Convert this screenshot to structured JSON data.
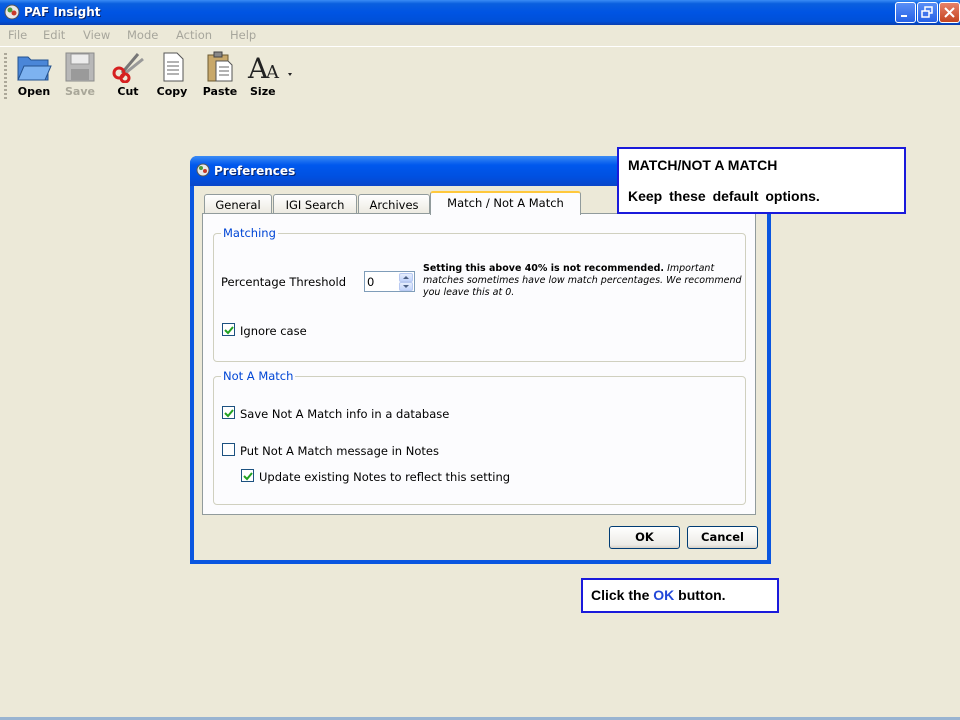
{
  "window": {
    "title": "PAF Insight"
  },
  "menu": [
    "File",
    "Edit",
    "View",
    "Mode",
    "Action",
    "Help"
  ],
  "toolbar": {
    "open": "Open",
    "save": "Save",
    "cut": "Cut",
    "copy": "Copy",
    "paste": "Paste",
    "size": "Size"
  },
  "dialog": {
    "title": "Preferences",
    "tabs": [
      "General",
      "IGI Search",
      "Archives",
      "Match / Not A Match"
    ],
    "active_tab": "Match / Not A Match",
    "matching": {
      "group_title": "Matching",
      "threshold_label": "Percentage Threshold",
      "threshold_value": "0",
      "note_bold": "Setting this above 40% is not recommended.",
      "note_italic": "Important matches sometimes have low match percentages. We recommend you leave this at 0.",
      "ignore_case_label": "Ignore case",
      "ignore_case_checked": true
    },
    "not_a_match": {
      "group_title": "Not A Match",
      "save_db_label": "Save Not A Match info in a database",
      "save_db_checked": true,
      "put_notes_label": "Put Not A Match message in Notes",
      "put_notes_checked": false,
      "update_notes_label": "Update existing Notes to reflect this setting",
      "update_notes_checked": true
    },
    "ok_label": "OK",
    "cancel_label": "Cancel"
  },
  "callouts": {
    "top_heading": "MATCH/NOT A MATCH",
    "top_text": "Keep these default options.",
    "bottom_pre": "Click the",
    "bottom_ok": "OK",
    "bottom_post": "button."
  },
  "colors": {
    "titlebar": "#0054e3",
    "callout_border": "#1a1adb",
    "group_title": "#0046d5"
  }
}
